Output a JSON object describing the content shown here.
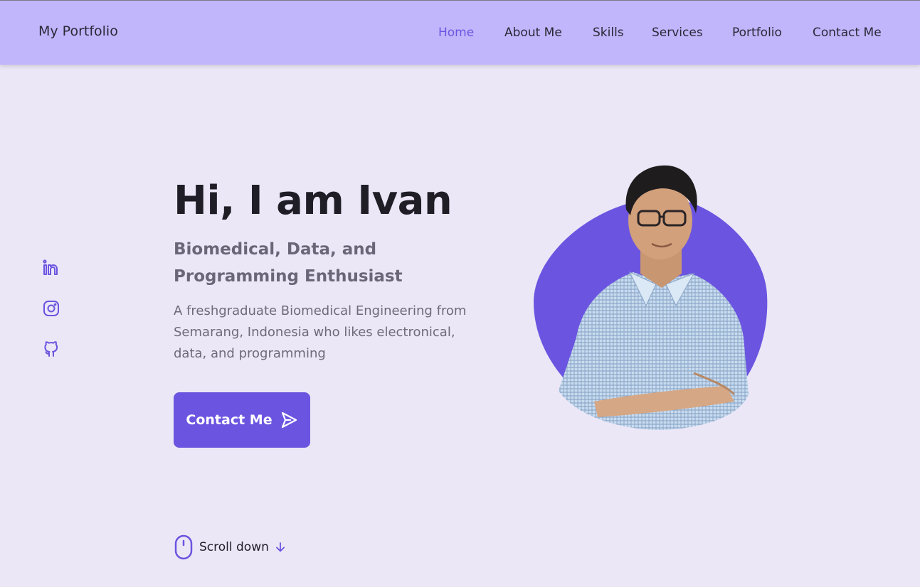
{
  "header": {
    "logo": "My Portfolio",
    "nav": [
      {
        "label": "Home",
        "active": true
      },
      {
        "label": "About Me",
        "active": false
      },
      {
        "label": "Skills",
        "active": false
      },
      {
        "label": "Services",
        "active": false
      },
      {
        "label": "Portfolio",
        "active": false
      },
      {
        "label": "Contact Me",
        "active": false
      }
    ]
  },
  "social": [
    {
      "icon": "linkedin-icon"
    },
    {
      "icon": "instagram-icon"
    },
    {
      "icon": "github-icon"
    }
  ],
  "hero": {
    "title": "Hi, I am Ivan",
    "subtitle": "Biomedical, Data, and Programming Enthusiast",
    "description": "A freshgraduate Biomedical Engineering from Semarang, Indonesia who likes electronical, data, and programming",
    "cta_label": "Contact Me",
    "cta_icon": "send-icon"
  },
  "scroll": {
    "label": "Scroll down",
    "icon": "mouse-icon",
    "arrow_icon": "arrow-down-icon"
  },
  "colors": {
    "accent": "#6b55e0",
    "header_bg": "#c1b6fc",
    "page_bg": "#ebe7f7"
  }
}
